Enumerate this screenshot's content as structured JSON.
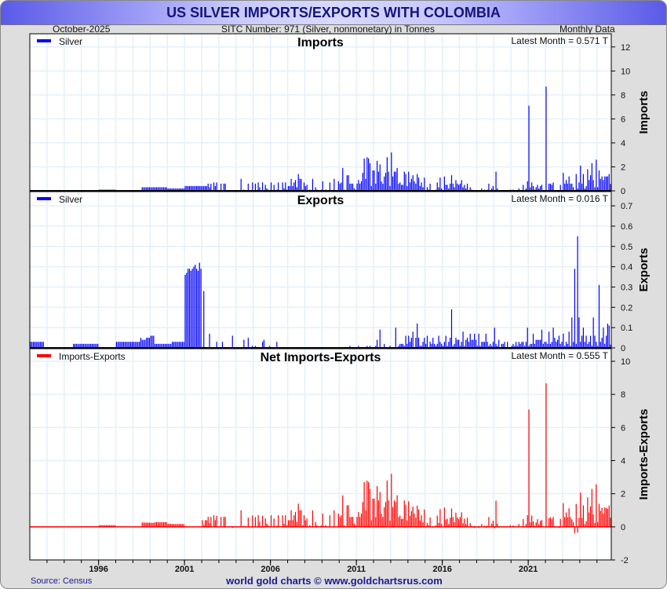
{
  "header": {
    "title": "US SILVER IMPORTS/EXPORTS WITH COLOMBIA",
    "date": "October-2025",
    "subtitle": "SITC Number: 971 (Silver, nonmonetary) in Tonnes",
    "frequency": "Monthly Data"
  },
  "footer": {
    "source": "Source: Census",
    "site": "world gold charts © www.goldchartsrus.com"
  },
  "colors": {
    "silver": "#0000ff",
    "net": "#ff0000"
  },
  "chart_data": [
    {
      "type": "bar",
      "title": "Imports",
      "ylabel": "Imports",
      "legend": "Silver",
      "legend_position": "top-left",
      "latest": "Latest Month = 0.571 T",
      "ylim": [
        0,
        13.1
      ],
      "yticks": [
        0,
        2,
        4,
        6,
        8,
        10,
        12
      ],
      "grid": true,
      "start": "1992-01",
      "x_ticks": [
        "1996",
        "2001",
        "2006",
        "2011",
        "2016",
        "2021"
      ],
      "values": [
        0,
        0,
        0,
        0,
        0,
        0,
        0,
        0,
        0,
        0,
        0,
        0,
        0,
        0,
        0,
        0,
        0,
        0,
        0,
        0,
        0,
        0,
        0,
        0,
        0,
        0,
        0,
        0,
        0,
        0,
        0,
        0,
        0,
        0,
        0,
        0,
        0,
        0.05,
        0.05,
        0.05,
        0.05,
        0.05,
        0.05,
        0.05,
        0.05,
        0.05,
        0.05,
        0.05,
        0.1,
        0.1,
        0.1,
        0.1,
        0.1,
        0.1,
        0.1,
        0.1,
        0.1,
        0.1,
        0.1,
        0.1,
        0.05,
        0.05,
        0.05,
        0.05,
        0.05,
        0.05,
        0.05,
        0.05,
        0.05,
        0.05,
        0.05,
        0.05,
        0.05,
        0.05,
        0.05,
        0.05,
        0.05,
        0.05,
        0.3,
        0.3,
        0.3,
        0.3,
        0.3,
        0.3,
        0.3,
        0.3,
        0.3,
        0.3,
        0.3,
        0.3,
        0.3,
        0.3,
        0.3,
        0.3,
        0.3,
        0.3,
        0.2,
        0.2,
        0.2,
        0.2,
        0.2,
        0.2,
        0.2,
        0.2,
        0.2,
        0.2,
        0.2,
        0.2,
        0.4,
        0.4,
        0.4,
        0.4,
        0.4,
        0.4,
        0.4,
        0.4,
        0.4,
        0.4,
        0.4,
        0.4,
        0.4,
        0.4,
        0.4,
        0.4,
        0.6,
        0.3,
        0.6,
        0,
        0.7,
        0.4,
        0.7,
        0,
        0,
        0.6,
        0,
        0.6,
        0.6,
        0,
        0,
        0,
        0,
        0,
        0,
        0,
        0,
        0,
        0,
        1.0,
        0,
        0.1,
        0,
        0,
        0.6,
        0,
        0,
        0.7,
        0,
        0.6,
        0,
        0.7,
        0.3,
        0,
        0.7,
        0,
        0.5,
        0.2,
        0.1,
        0,
        0.7,
        0,
        0.5,
        0,
        0.1,
        0.7,
        0,
        0,
        0.7,
        0.2,
        0.7,
        0.1,
        0.4,
        0.4,
        1.0,
        0.4,
        0.7,
        0.9,
        0.3,
        1.4,
        1.0,
        1.0,
        0.1,
        0.7,
        0.4,
        0.5,
        0,
        0.1,
        0,
        1.0,
        0,
        0.3,
        0.1,
        0,
        0,
        0.1,
        0.8,
        0,
        0.1,
        0,
        0,
        0.7,
        0,
        0,
        1.0,
        0,
        0,
        0.8,
        0.6,
        0.7,
        1.9,
        0.1,
        0,
        1.3,
        1.3,
        0.6,
        0.6,
        0.6,
        0.2,
        0.1,
        0.6,
        0.9,
        0.6,
        0.8,
        1.5,
        2.7,
        1.0,
        2.8,
        2.7,
        2.3,
        0.4,
        1.7,
        1.7,
        0.6,
        2.5,
        1.6,
        2.2,
        0.8,
        0.6,
        1.2,
        1.5,
        2.8,
        1.6,
        0.4,
        3.2,
        1.2,
        1.6,
        1.6,
        1.9,
        0.6,
        0.7,
        0.5,
        0.5,
        1.6,
        1.4,
        0.4,
        1.6,
        0.7,
        1.0,
        1.3,
        0.8,
        0.6,
        1.4,
        1.1,
        0.4,
        0.7,
        0.3,
        1.1,
        0,
        0.3,
        0.1,
        0.6,
        0,
        0,
        0,
        0.1,
        0.7,
        0.3,
        1.1,
        0.2,
        0,
        1.2,
        0.5,
        0.5,
        0.2,
        0.6,
        1.3,
        0.6,
        0.3,
        0.9,
        0.6,
        0.5,
        0.6,
        0.9,
        0.3,
        0.5,
        0.2,
        0.6,
        0,
        0.3,
        0.1,
        0,
        0,
        0,
        0,
        0,
        0,
        0.2,
        0,
        0.1,
        0,
        0.1,
        0.6,
        0,
        0.2,
        0.4,
        0,
        1.6,
        0.2,
        0,
        0,
        0,
        0,
        0,
        0,
        0,
        0,
        0.1,
        0,
        0.1,
        0,
        0,
        0,
        0.2,
        0,
        0,
        0.5,
        0,
        0.2,
        0.8,
        7.1,
        0.3,
        0.7,
        0.4,
        0.1,
        0.3,
        0.5,
        0.2,
        0.4,
        0.5,
        0,
        0,
        8.7,
        0,
        0.6,
        0.6,
        0.5,
        0.7,
        0,
        0,
        0,
        0,
        0.5,
        0,
        1.5,
        0.6,
        0.9,
        0.6,
        1.2,
        0.6,
        0.6,
        0.3,
        0,
        1.4,
        0.2,
        0.7,
        2.1,
        0.6,
        1.4,
        0.2,
        0.4,
        1.8,
        0.9,
        1.3,
        2.3,
        0.9,
        0.3,
        2.6,
        0.3,
        1.7,
        1.0,
        1.2,
        0.9,
        1.2,
        1.2,
        1.2,
        1.4,
        0.571
      ]
    },
    {
      "type": "bar",
      "title": "Exports",
      "ylabel": "Exports",
      "legend": "Silver",
      "legend_position": "top-left",
      "latest": "Latest Month = 0.016 T",
      "ylim": [
        0,
        0.77
      ],
      "yticks": [
        0,
        0.1,
        0.2,
        0.3,
        0.4,
        0.5,
        0.6,
        0.7
      ],
      "grid": true,
      "start": "1992-01",
      "values": [
        0.03,
        0.03,
        0.03,
        0.03,
        0.03,
        0.03,
        0.03,
        0.03,
        0.03,
        0.03,
        0,
        0,
        0,
        0,
        0,
        0,
        0,
        0,
        0,
        0,
        0,
        0,
        0,
        0,
        0,
        0,
        0,
        0,
        0,
        0,
        0.02,
        0.02,
        0.02,
        0.02,
        0.02,
        0.02,
        0.02,
        0.02,
        0.02,
        0.02,
        0.02,
        0.02,
        0.02,
        0.02,
        0.02,
        0.02,
        0.02,
        0.02,
        0,
        0,
        0,
        0,
        0,
        0,
        0,
        0,
        0,
        0,
        0,
        0,
        0.03,
        0.03,
        0.03,
        0.03,
        0.03,
        0.03,
        0.03,
        0.03,
        0.03,
        0.03,
        0.03,
        0.03,
        0.03,
        0.03,
        0.03,
        0.03,
        0.03,
        0.05,
        0.04,
        0.04,
        0.04,
        0.05,
        0.05,
        0.05,
        0.06,
        0.06,
        0.06,
        0.02,
        0.02,
        0.02,
        0.02,
        0.02,
        0.02,
        0.02,
        0.02,
        0.02,
        0.02,
        0.02,
        0.02,
        0.03,
        0.03,
        0.03,
        0.03,
        0.03,
        0.03,
        0.03,
        0.03,
        0.03,
        0.36,
        0.37,
        0.39,
        0.39,
        0.38,
        0.39,
        0.4,
        0.41,
        0.39,
        0.38,
        0.42,
        0.39,
        0,
        0.28,
        0,
        0,
        0,
        0.07,
        0,
        0,
        0,
        0,
        0.03,
        0,
        0,
        0,
        0.03,
        0,
        0,
        0,
        0,
        0,
        0,
        0.06,
        0,
        0,
        0,
        0,
        0,
        0,
        0,
        0.04,
        0,
        0,
        0.05,
        0,
        0,
        0.01,
        0,
        0.01,
        0,
        0,
        0,
        0,
        0.03,
        0.04,
        0,
        0,
        0,
        0.01,
        0,
        0,
        0,
        0,
        0.03,
        0,
        0,
        0,
        0,
        0,
        0,
        0,
        0,
        0,
        0,
        0,
        0,
        0,
        0,
        0,
        0,
        0,
        0,
        0,
        0,
        0,
        0,
        0,
        0,
        0,
        0,
        0,
        0,
        0,
        0,
        0,
        0,
        0,
        0,
        0,
        0,
        0,
        0,
        0,
        0,
        0,
        0,
        0,
        0,
        0,
        0,
        0,
        0,
        0,
        0,
        0.01,
        0,
        0,
        0,
        0,
        0,
        0.01,
        0,
        0,
        0,
        0,
        0,
        0.01,
        0,
        0.01,
        0,
        0,
        0,
        0.01,
        0.04,
        0,
        0.09,
        0,
        0,
        0.02,
        0,
        0,
        0,
        0.01,
        0,
        0,
        0,
        0.1,
        0,
        0.01,
        0.02,
        0.02,
        0.02,
        0.01,
        0.06,
        0.02,
        0.06,
        0.03,
        0.05,
        0.08,
        0,
        0.05,
        0.12,
        0.05,
        0.01,
        0.01,
        0.03,
        0.05,
        0.02,
        0.06,
        0,
        0.03,
        0.02,
        0.05,
        0.02,
        0.01,
        0.02,
        0.06,
        0.03,
        0.02,
        0.01,
        0.03,
        0.06,
        0.01,
        0.03,
        0.05,
        0.19,
        0.01,
        0.02,
        0.05,
        0.04,
        0.04,
        0.01,
        0.03,
        0.08,
        0.01,
        0.04,
        0.05,
        0.03,
        0.07,
        0.04,
        0.04,
        0.07,
        0.04,
        0.01,
        0.07,
        0.01,
        0.03,
        0.03,
        0.03,
        0.07,
        0.03,
        0.01,
        0.02,
        0.01,
        0.03,
        0.1,
        0.02,
        0.01,
        0.04,
        0,
        0.02,
        0.02,
        0.03,
        0,
        0.03,
        0,
        0,
        0.01,
        0.02,
        0.01,
        0.03,
        0.01,
        0.03,
        0.02,
        0.03,
        0.03,
        0.01,
        0.03,
        0.1,
        0.01,
        0.02,
        0.02,
        0.07,
        0.02,
        0.04,
        0.04,
        0.04,
        0.04,
        0.09,
        0.02,
        0.03,
        0.03,
        0.02,
        0.08,
        0.02,
        0.03,
        0.1,
        0.05,
        0.03,
        0.04,
        0.06,
        0.02,
        0.03,
        0.07,
        0.01,
        0.03,
        0.02,
        0.08,
        0.01,
        0.15,
        0.03,
        0.39,
        0.02,
        0.55,
        0.15,
        0.03,
        0.06,
        0.1,
        0.03,
        0.06,
        0.02,
        0.03,
        0.06,
        0.01,
        0.15,
        0.06,
        0.03,
        0.01,
        0.31,
        0.03,
        0.05,
        0.1,
        0.02,
        0.06,
        0.12,
        0.11,
        0.016
      ]
    },
    {
      "type": "bar",
      "title": "Net Imports-Exports",
      "ylabel": "Imports-Exports",
      "legend": "Imports-Exports",
      "legend_position": "top-left",
      "latest": "Latest Month = 0.555 T",
      "ylim": [
        -2,
        10.76
      ],
      "yticks": [
        -2,
        0,
        2,
        4,
        6,
        8,
        10
      ],
      "grid": true,
      "start": "1992-01",
      "derived": "imports minus exports",
      "x_ticks": [
        "1996",
        "2001",
        "2006",
        "2011",
        "2016",
        "2021"
      ]
    }
  ]
}
